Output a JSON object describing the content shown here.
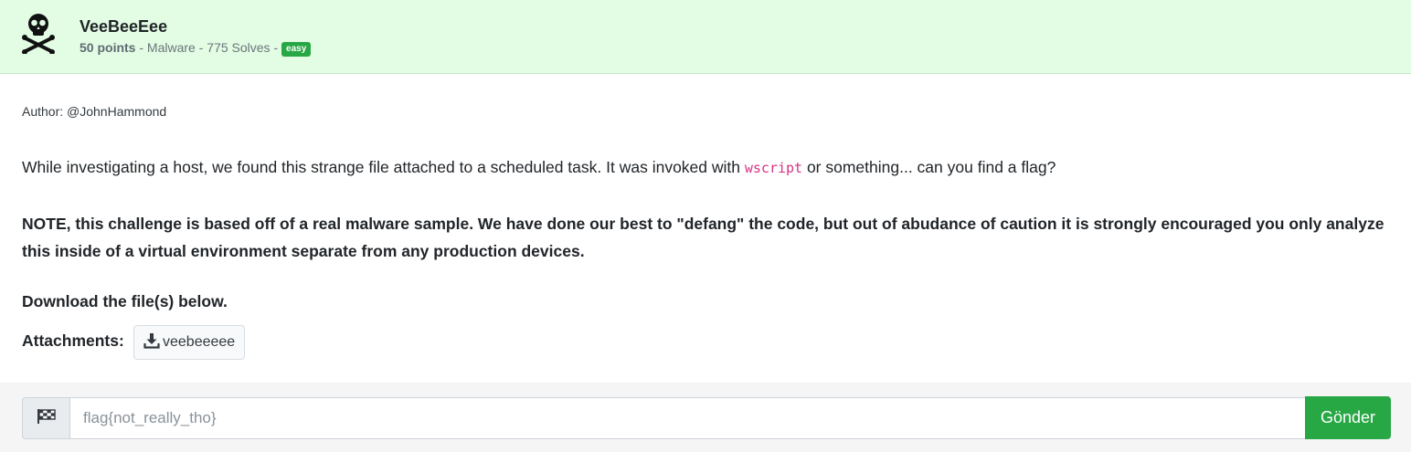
{
  "challenge": {
    "icon": "skull-crossbones-icon",
    "title": "VeeBeeEee",
    "points": "50 points",
    "category": "Malware",
    "solves": "775 Solves",
    "difficulty": "easy",
    "separator": " - "
  },
  "body": {
    "author": "Author: @JohnHammond",
    "desc_before": "While investigating a host, we found this strange file attached to a scheduled task. It was invoked with ",
    "desc_code": "wscript",
    "desc_after": " or something... can you find a flag?",
    "note": "NOTE, this challenge is based off of a real malware sample. We have done our best to \"defang\" the code, but out of abudance of caution it is strongly encouraged you only analyze this inside of a virtual environment separate from any production devices.",
    "download_text": "Download the file(s) below.",
    "attachments_label": "Attachments:",
    "attachment_name": "veebeeeee",
    "attachment_icon": "download-icon"
  },
  "submission": {
    "flag_icon": "checkered-flag-icon",
    "placeholder": "flag{not_really_tho}",
    "value": "",
    "submit_label": "Gönder"
  },
  "colors": {
    "header_bg": "#e2fde3",
    "accent_green": "#28a745",
    "code_pink": "#d63384",
    "footer_bg": "#f5f5f5"
  }
}
